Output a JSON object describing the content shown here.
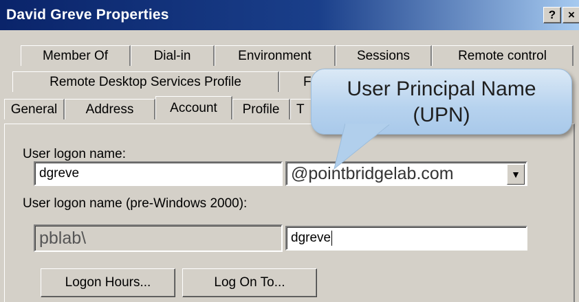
{
  "window": {
    "title": "David Greve Properties",
    "help_label": "?",
    "close_label": "×"
  },
  "tabs": {
    "row1": [
      "Member Of",
      "Dial-in",
      "Environment",
      "Sessions",
      "Remote control"
    ],
    "row2": [
      "Remote Desktop Services Profile",
      "F"
    ],
    "row3": [
      "General",
      "Address",
      "Account",
      "Profile",
      "T"
    ],
    "active": "Account"
  },
  "callout": {
    "line1": "User Principal Name",
    "line2": "(UPN)"
  },
  "account": {
    "logon_name_label": "User logon name:",
    "logon_name_value": "dgreve",
    "upn_suffix": "@pointbridgelab.com",
    "pre2000_label": "User logon name (pre-Windows 2000):",
    "domain_value": "pblab\\",
    "pre2000_value": "dgreve",
    "logon_hours_button": "Logon Hours...",
    "log_on_to_button": "Log On To..."
  }
}
